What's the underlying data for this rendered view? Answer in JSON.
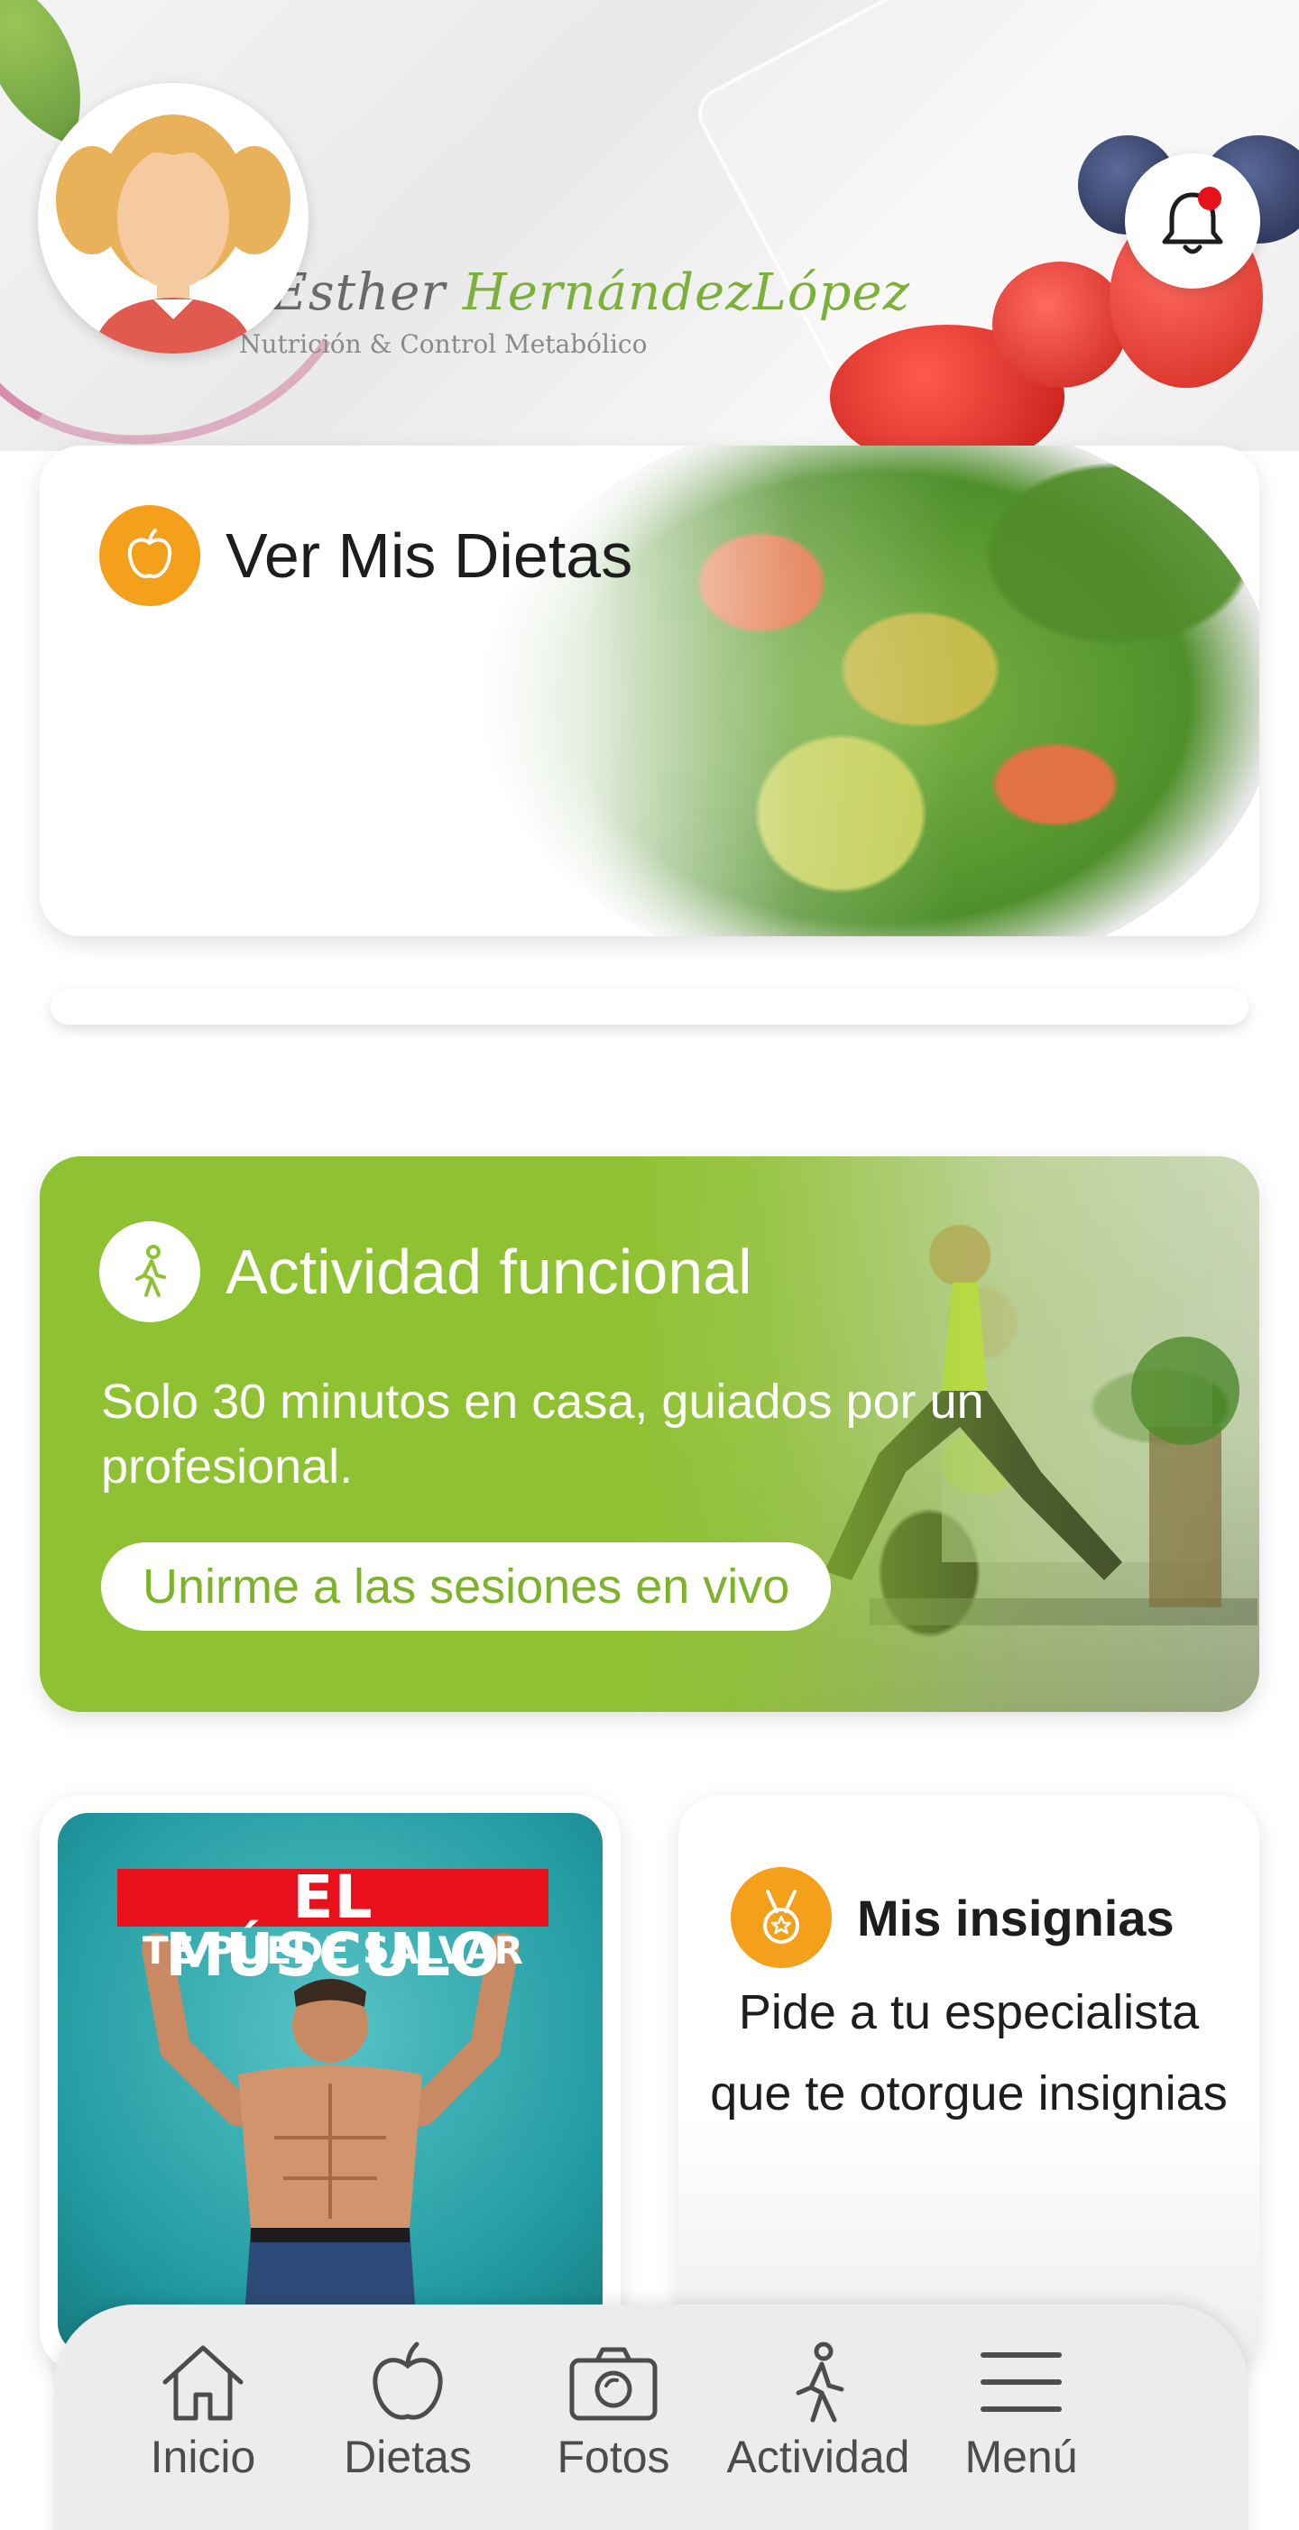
{
  "header": {
    "brand_first": "Esther",
    "brand_last": "HernándezLópez",
    "brand_subtitle": "Nutrición & Control Metabólico"
  },
  "diet_card": {
    "title": "Ver Mis Dietas",
    "icon": "apple-icon",
    "icon_color": "#f5a01a"
  },
  "activity_card": {
    "title": "Actividad funcional",
    "description": "Solo 30 minutos en casa, guiados por un profesional.",
    "button_label": "Unirme a las sesiones en vivo",
    "icon": "walking-person-icon",
    "accent_color": "#8fc232"
  },
  "promo_card": {
    "headline_1": "EL MÚSCULO",
    "headline_2": "TE PUEDE SALVAR"
  },
  "badges_card": {
    "title": "Mis insignias",
    "description": "Pide a tu especialista que te otorgue insignias",
    "icon": "medal-icon"
  },
  "bottom_nav": {
    "items": [
      {
        "label": "Inicio",
        "icon": "home-icon"
      },
      {
        "label": "Dietas",
        "icon": "apple-icon"
      },
      {
        "label": "Fotos",
        "icon": "camera-icon"
      },
      {
        "label": "Actividad",
        "icon": "walking-person-icon"
      },
      {
        "label": "Menú",
        "icon": "hamburger-menu-icon"
      }
    ]
  },
  "notifications": {
    "icon": "bell-icon",
    "has_unread": true,
    "dot_color": "#e8101a"
  }
}
